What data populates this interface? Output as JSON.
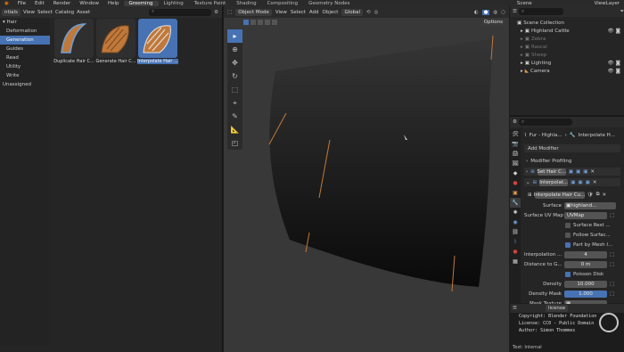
{
  "topbar": {
    "menus": [
      "File",
      "Edit",
      "Render",
      "Window",
      "Help"
    ],
    "workspaces": [
      "Grooming",
      "Lighting",
      "Texture Paint",
      "Shading",
      "Compositing",
      "Geometry Nodes"
    ],
    "active_workspace": "Grooming",
    "scene": "Scene",
    "view_layer": "ViewLayer"
  },
  "asset_browser": {
    "library": "ntials",
    "menus": [
      "View",
      "Select",
      "Catalog",
      "Asset"
    ],
    "tree": [
      "Hair",
      "Deformation",
      "Generation",
      "Guides",
      "Read",
      "Utility",
      "Write",
      "Unassigned"
    ],
    "selected_catalog": "Generation",
    "assets": [
      {
        "label": "Duplicate Hair C..."
      },
      {
        "label": "Generate Hair C..."
      },
      {
        "label": "Interpolate Hair ..."
      }
    ]
  },
  "viewport": {
    "mode": "Object Mode",
    "menus": [
      "View",
      "Select",
      "Add",
      "Object"
    ],
    "transform": "Global",
    "options_label": "Options"
  },
  "outliner": {
    "title": "Scene Collection",
    "items": [
      {
        "label": "Highland Cattle",
        "dim": false
      },
      {
        "label": "Zebra",
        "dim": true
      },
      {
        "label": "Rascal",
        "dim": true
      },
      {
        "label": "Sheep",
        "dim": true
      },
      {
        "label": "Lighting",
        "dim": false
      },
      {
        "label": "Camera",
        "dim": false
      }
    ]
  },
  "properties": {
    "breadcrumb_object": "Fur - Highla...",
    "breadcrumb_modifier": "Interpolate H...",
    "add_modifier": "Add Modifier",
    "panels": [
      "Modifier Profiling"
    ],
    "modifiers": [
      "Set Hair C...",
      "Interpolat..."
    ],
    "node_group": "Interpolate Hair Cu...",
    "surface_label": "Surface",
    "surface_value": "highland...",
    "uv_label": "Surface UV Map",
    "uv_value": "UVMap",
    "checks": [
      {
        "label": "Surface Rest ...",
        "on": false
      },
      {
        "label": "Follow Surfac...",
        "on": false
      },
      {
        "label": "Part by Mesh I...",
        "on": true
      }
    ],
    "interp_label": "Interpolation ...",
    "interp_value": "4",
    "dist_label": "Distance to G...",
    "dist_value": "0 m",
    "poisson_label": "Poisson Disk",
    "poisson_on": true,
    "density_label": "Density",
    "density_value": "10.000",
    "density_mask_label": "Density Mask",
    "density_mask_value": "1.000",
    "mask_texture_label": "Mask Texture"
  },
  "console": {
    "header": "license",
    "lines": [
      "Copyright: Blender Foundation",
      "License: CC0 - Public Domain",
      "Author: Simon Thommes"
    ],
    "footer": "Text: Internal"
  },
  "colors": {
    "accent": "#4772b3",
    "hair": "#c0793a"
  }
}
